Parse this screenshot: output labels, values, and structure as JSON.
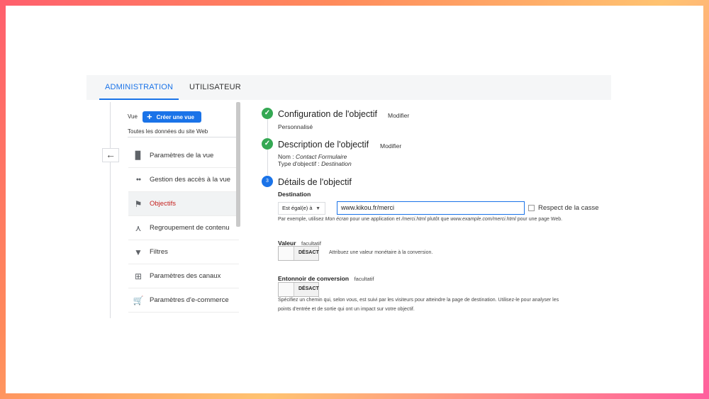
{
  "tabs": {
    "admin": "ADMINISTRATION",
    "user": "UTILISATEUR"
  },
  "sidebar": {
    "vue_label": "Vue",
    "create_button": "Créer une vue",
    "subtitle": "Toutes les données du site Web",
    "back_icon": "arrow-left-icon",
    "items": [
      {
        "label": "Paramètres de la vue",
        "icon": "document-icon",
        "glyph": "▉",
        "active": false
      },
      {
        "label": "Gestion des accès à la vue",
        "icon": "people-icon",
        "glyph": "●●",
        "active": false
      },
      {
        "label": "Objectifs",
        "icon": "flag-icon",
        "glyph": "⚑",
        "active": true
      },
      {
        "label": "Regroupement de contenu",
        "icon": "merge-icon",
        "glyph": "⋏",
        "active": false
      },
      {
        "label": "Filtres",
        "icon": "filter-icon",
        "glyph": "▼",
        "active": false
      },
      {
        "label": "Paramètres des canaux",
        "icon": "channels-icon",
        "glyph": "⊞",
        "active": false
      },
      {
        "label": "Paramètres d'e-commerce",
        "icon": "cart-icon",
        "glyph": "🛒",
        "active": false
      }
    ]
  },
  "steps": {
    "s1": {
      "title": "Configuration de l'objectif",
      "modify": "Modifier",
      "value": "Personnalisé"
    },
    "s2": {
      "title": "Description de l'objectif",
      "modify": "Modifier",
      "name_label": "Nom :",
      "name_value": "Contact Formulaire",
      "type_label": "Type d'objectif :",
      "type_value": "Destination"
    },
    "s3": {
      "number": "3",
      "title": "Détails de l'objectif",
      "destination_label": "Destination",
      "match_select": "Est égal(e) à",
      "url_value": "www.kikou.fr/merci",
      "case_label": "Respect de la casse",
      "hint_p1": "Par exemple, utilisez ",
      "hint_i1": "Mon écran",
      "hint_p2": " pour une application et ",
      "hint_i2": "/merci.html",
      "hint_p3": " plutôt que ",
      "hint_i3": "www.example.com/merci.html",
      "hint_p4": " pour une page Web.",
      "value_label": "Valeur",
      "value_optional": "facultatif",
      "value_toggle": "DÉSACT",
      "value_hint": "Attribuez une valeur monétaire à la conversion.",
      "funnel_label": "Entonnoir de conversion",
      "funnel_optional": "facultatif",
      "funnel_toggle": "DÉSACT",
      "funnel_hint_1": "Spécifiez un chemin qui, selon vous, est suivi par les visiteurs pour atteindre la page de destination. Utilisez-le pour analyser les",
      "funnel_hint_2": "points d'entrée et de sortie qui ont un impact sur votre objectif."
    }
  },
  "colors": {
    "accent": "#1a73e8",
    "success": "#34a853",
    "active_nav": "#c5221f"
  }
}
